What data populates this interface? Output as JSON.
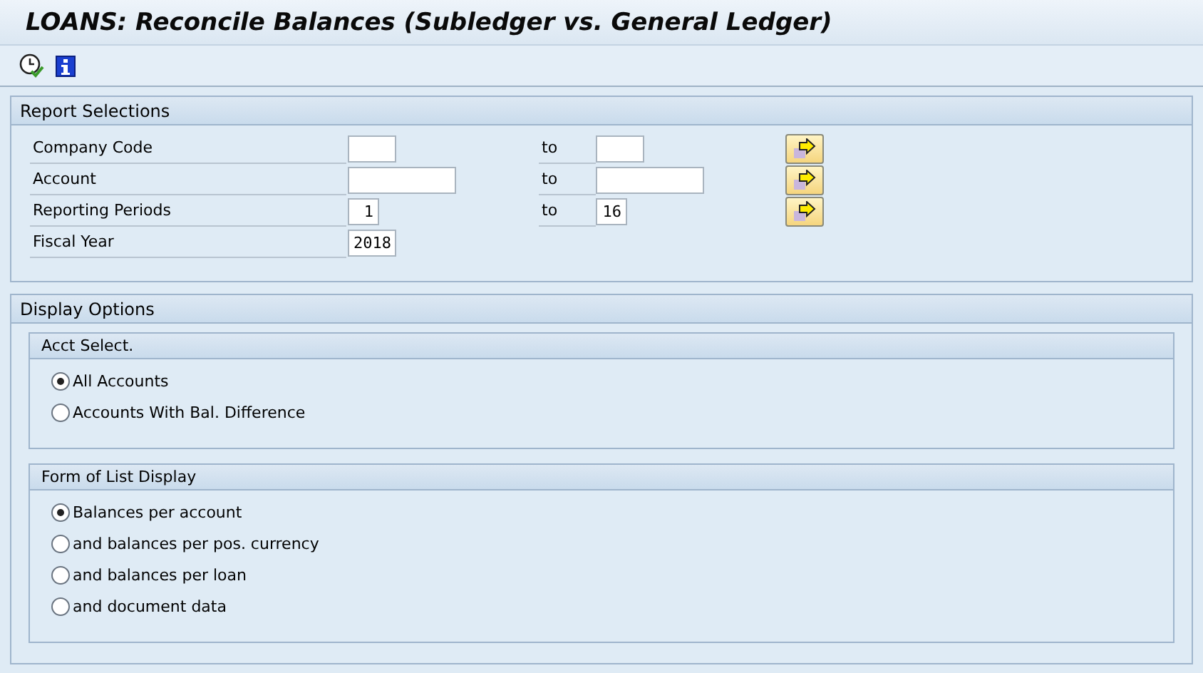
{
  "title": "LOANS: Reconcile Balances (Subledger vs. General Ledger)",
  "selections": {
    "title": "Report Selections",
    "rows": [
      {
        "label": "Company Code",
        "from": "",
        "to_label": "to",
        "to": "",
        "has_more": true
      },
      {
        "label": "Account",
        "from": "",
        "to_label": "to",
        "to": "",
        "has_more": true
      },
      {
        "label": "Reporting Periods",
        "from": "1",
        "to_label": "to",
        "to": "16",
        "has_more": true
      },
      {
        "label": "Fiscal Year",
        "from": "2018",
        "has_more": false
      }
    ]
  },
  "display": {
    "title": "Display Options",
    "groups": [
      {
        "title": "Acct Select.",
        "options": [
          {
            "label": "All Accounts",
            "selected": true
          },
          {
            "label": "Accounts With Bal. Difference",
            "selected": false
          }
        ]
      },
      {
        "title": "Form of List Display",
        "options": [
          {
            "label": "Balances per account",
            "selected": true
          },
          {
            "label": "and balances per pos. currency",
            "selected": false
          },
          {
            "label": "and balances per loan",
            "selected": false
          },
          {
            "label": "and document data",
            "selected": false
          }
        ]
      }
    ]
  }
}
